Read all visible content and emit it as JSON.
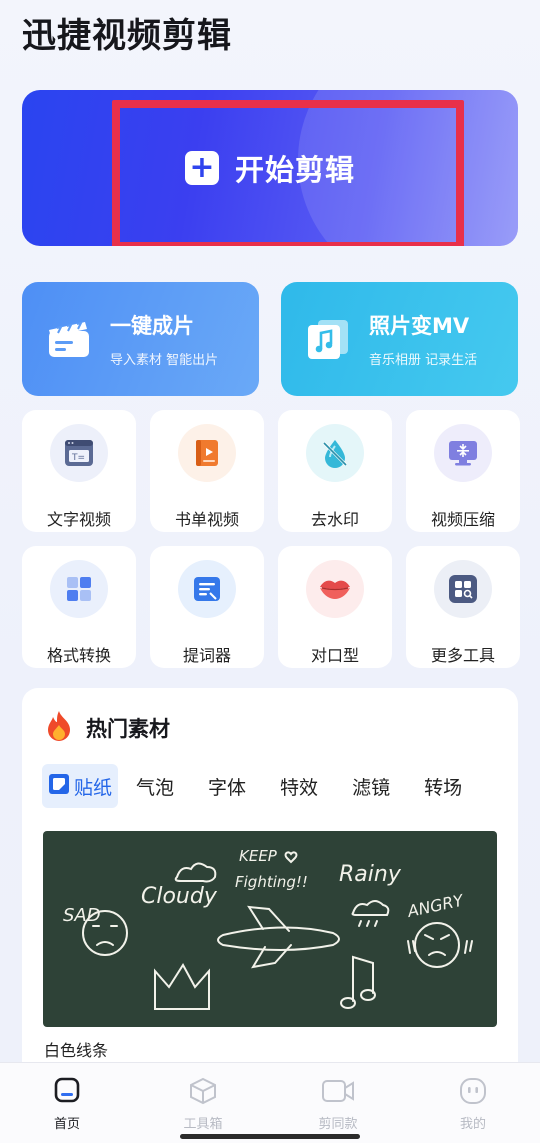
{
  "app": {
    "title": "迅捷视频剪辑"
  },
  "hero": {
    "label": "开始剪辑",
    "plus": "+"
  },
  "features": [
    {
      "title": "一键成片",
      "subtitle": "导入素材 智能出片",
      "icon": "clapperboard-icon"
    },
    {
      "title": "照片变MV",
      "subtitle": "音乐相册 记录生活",
      "icon": "music-photo-icon"
    }
  ],
  "tools": [
    {
      "label": "文字视频",
      "icon": "text-video-icon"
    },
    {
      "label": "书单视频",
      "icon": "book-video-icon"
    },
    {
      "label": "去水印",
      "icon": "watermark-drop-icon"
    },
    {
      "label": "视频压缩",
      "icon": "compress-monitor-icon"
    },
    {
      "label": "格式转换",
      "icon": "format-convert-icon"
    },
    {
      "label": "提词器",
      "icon": "teleprompter-icon"
    },
    {
      "label": "对口型",
      "icon": "lips-icon"
    },
    {
      "label": "更多工具",
      "icon": "more-grid-icon"
    }
  ],
  "hot": {
    "title": "热门素材",
    "tabs": [
      "贴纸",
      "气泡",
      "字体",
      "特效",
      "滤镜",
      "转场"
    ],
    "active_tab": "贴纸",
    "sticker": {
      "caption": "白色线条",
      "words": [
        "SAD",
        "Cloudy",
        "KEEP",
        "Fighting!!",
        "Rainy",
        "ANGRY"
      ]
    }
  },
  "tabbar": [
    {
      "label": "首页",
      "icon": "home-icon",
      "active": true
    },
    {
      "label": "工具箱",
      "icon": "toolbox-cube-icon",
      "active": false
    },
    {
      "label": "剪同款",
      "icon": "video-camera-icon",
      "active": false
    },
    {
      "label": "我的",
      "icon": "profile-face-icon",
      "active": false
    }
  ],
  "colors": {
    "accent": "#2f44ee",
    "highlight_border": "#e8304a",
    "active_tab": "#2466e8"
  }
}
